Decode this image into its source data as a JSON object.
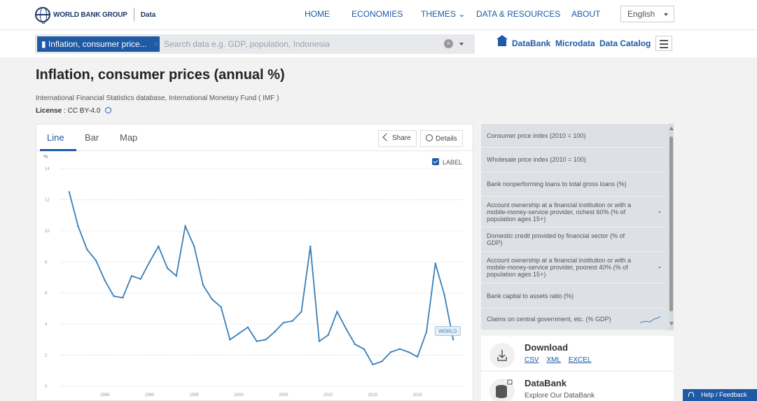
{
  "brand": {
    "logo_text": "WORLD BANK GROUP",
    "product": "Data"
  },
  "nav": [
    {
      "label": "HOME"
    },
    {
      "label": "ECONOMIES"
    },
    {
      "label": "THEMES"
    },
    {
      "label": "DATA & RESOURCES"
    },
    {
      "label": "ABOUT"
    }
  ],
  "language": "English",
  "search": {
    "chip": "Inflation, consumer price...",
    "placeholder": "Search data e.g. GDP, population, Indonesia"
  },
  "quick_links": [
    "DataBank",
    "Microdata",
    "Data Catalog"
  ],
  "indicator": {
    "title": "Inflation, consumer prices (annual %)",
    "source": "International Financial Statistics database, International Monetary Fund ( IMF )",
    "license_label": "License",
    "license_value": ": CC BY-4.0"
  },
  "chart_tabs": [
    "Line",
    "Bar",
    "Map"
  ],
  "chart_buttons": {
    "share": "Share",
    "details": "Details"
  },
  "label_toggle": "LABEL",
  "chart_data": {
    "type": "line",
    "ylabel": "%",
    "ylim": [
      0,
      14
    ],
    "yticks": [
      0,
      2,
      4,
      6,
      8,
      10,
      12,
      14
    ],
    "xlim": [
      1980,
      2025
    ],
    "xticks": [
      1985,
      1990,
      1995,
      2000,
      2005,
      2010,
      2015,
      2020
    ],
    "grid": true,
    "series": [
      {
        "name": "WORLD",
        "color": "#3a7fb8",
        "x": [
          1981,
          1982,
          1983,
          1984,
          1985,
          1986,
          1987,
          1988,
          1989,
          1990,
          1991,
          1992,
          1993,
          1994,
          1995,
          1996,
          1997,
          1998,
          1999,
          2000,
          2001,
          2002,
          2003,
          2004,
          2005,
          2006,
          2007,
          2008,
          2009,
          2010,
          2011,
          2012,
          2013,
          2014,
          2015,
          2016,
          2017,
          2018,
          2019,
          2020,
          2021,
          2022,
          2023,
          2024
        ],
        "values": [
          12.5,
          10.3,
          8.8,
          8.1,
          6.8,
          5.8,
          5.7,
          7.1,
          6.9,
          8.0,
          9.0,
          7.6,
          7.1,
          10.3,
          9.0,
          6.5,
          5.6,
          5.1,
          3.0,
          3.4,
          3.8,
          2.9,
          3.0,
          3.5,
          4.1,
          4.2,
          4.8,
          9.0,
          2.9,
          3.3,
          4.8,
          3.7,
          2.7,
          2.4,
          1.4,
          1.6,
          2.2,
          2.4,
          2.2,
          1.9,
          3.5,
          7.9,
          5.9,
          3.0
        ]
      }
    ]
  },
  "related_indicators": [
    "Consumer price index (2010 = 100)",
    "Wholesale price index (2010 = 100)",
    "Bank nonperforming loans to total gross loans (%)",
    "Account ownership at a financial institution or with a mobile-money-service provider, richest 60% (% of population ages 15+)",
    "Domestic credit provided by financial sector (% of GDP)",
    "Account ownership at a financial institution or with a mobile-money-service provider, poorest 40% (% of population ages 15+)",
    "Bank capital to assets ratio (%)",
    "Claims on central government, etc. (% GDP)"
  ],
  "download": {
    "title": "Download",
    "formats": [
      "CSV",
      "XML",
      "EXCEL"
    ]
  },
  "databank": {
    "title": "DataBank",
    "subtitle": "Explore Our DataBank"
  },
  "help_button": "Help / Feedback"
}
